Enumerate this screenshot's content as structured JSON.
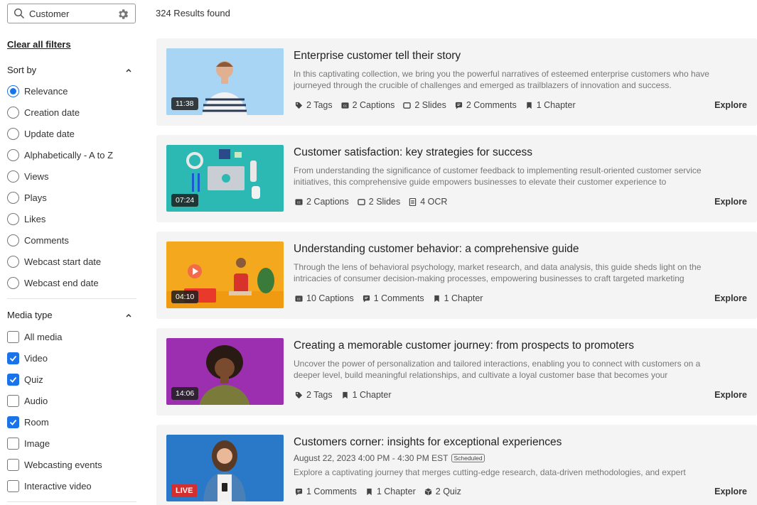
{
  "search": {
    "value": "Customer"
  },
  "filters": {
    "clear_label": "Clear all filters",
    "sort": {
      "title": "Sort by",
      "options": [
        "Relevance",
        "Creation date",
        "Update date",
        "Alphabetically - A to Z",
        "Views",
        "Plays",
        "Likes",
        "Comments",
        "Webcast start date",
        "Webcast end date"
      ],
      "selected": "Relevance"
    },
    "media": {
      "title": "Media type",
      "options": [
        {
          "label": "All media",
          "checked": false
        },
        {
          "label": "Video",
          "checked": true
        },
        {
          "label": "Quiz",
          "checked": true
        },
        {
          "label": "Audio",
          "checked": false
        },
        {
          "label": "Room",
          "checked": true
        },
        {
          "label": "Image",
          "checked": false
        },
        {
          "label": "Webcasting events",
          "checked": false
        },
        {
          "label": "Interactive video",
          "checked": false
        }
      ]
    }
  },
  "results_count": "324 Results found",
  "explore_label": "Explore",
  "accent_color": "#1a73e8",
  "results": [
    {
      "title": "Enterprise customer tell their story",
      "description": "In this captivating collection, we bring you the powerful narratives of esteemed enterprise customers who have journeyed through the crucible of challenges and emerged as trailblazers of innovation and success.",
      "duration": "11:38",
      "meta": [
        {
          "icon": "tag-icon",
          "text": "2 Tags"
        },
        {
          "icon": "caption-icon",
          "text": "2 Captions"
        },
        {
          "icon": "slide-icon",
          "text": "2 Slides"
        },
        {
          "icon": "comment-icon",
          "text": "2 Comments"
        },
        {
          "icon": "bookmark-icon",
          "text": "1 Chapter"
        }
      ]
    },
    {
      "title": "Customer satisfaction: key strategies for success",
      "description": "From understanding the significance of customer feedback to implementing result-oriented customer service initiatives, this comprehensive guide empowers businesses to elevate their customer experience to",
      "duration": "07:24",
      "meta": [
        {
          "icon": "caption-icon",
          "text": "2 Captions"
        },
        {
          "icon": "slide-icon",
          "text": "2 Slides"
        },
        {
          "icon": "ocr-icon",
          "text": "4 OCR"
        }
      ]
    },
    {
      "title": "Understanding customer behavior: a comprehensive guide",
      "description": "Through the lens of behavioral psychology, market research, and data analysis, this guide sheds light on the intricacies of consumer decision-making processes, empowering businesses to craft targeted marketing",
      "duration": "04:10",
      "meta": [
        {
          "icon": "caption-icon",
          "text": "10 Captions"
        },
        {
          "icon": "comment-icon",
          "text": "1 Comments"
        },
        {
          "icon": "bookmark-icon",
          "text": "1 Chapter"
        }
      ]
    },
    {
      "title": "Creating a memorable customer journey: from prospects to promoters",
      "description": "Uncover the power of personalization and tailored interactions, enabling you to connect with customers on a deeper level, build meaningful relationships, and cultivate a loyal customer base that becomes your",
      "duration": "14:06",
      "meta": [
        {
          "icon": "tag-icon",
          "text": "2 Tags"
        },
        {
          "icon": "bookmark-icon",
          "text": "1 Chapter"
        }
      ]
    },
    {
      "title": "Customers corner: insights for exceptional experiences",
      "date": "August 22, 2023 4:00 PM - 4:30 PM EST",
      "badge": "Scheduled",
      "description": "Explore a captivating journey that merges cutting-edge research, data-driven methodologies, and expert",
      "live": "LIVE",
      "meta": [
        {
          "icon": "comment-icon",
          "text": "1 Comments"
        },
        {
          "icon": "bookmark-icon",
          "text": "1 Chapter"
        },
        {
          "icon": "quiz-icon",
          "text": "2 Quiz"
        }
      ]
    }
  ]
}
